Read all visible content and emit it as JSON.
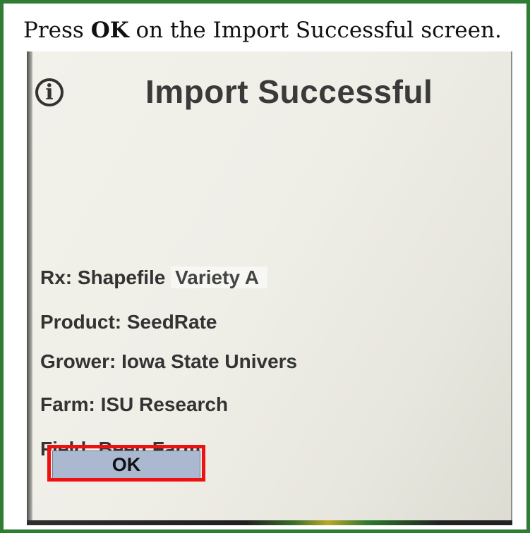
{
  "instruction": {
    "prefix": "Press ",
    "emphasis": "OK",
    "suffix": " on the Import Successful screen."
  },
  "dialog": {
    "icon": "info-icon",
    "title": "Import Successful",
    "lines": [
      {
        "label": "Rx: Shapefile",
        "value": "Variety A"
      },
      {
        "label": "Product: SeedRate"
      },
      {
        "label": "Grower: Iowa State Univers"
      },
      {
        "label": "Farm: ISU Research"
      },
      {
        "label": "Field: Been Farm"
      }
    ],
    "ok_label": "OK"
  },
  "colors": {
    "frame_border": "#2e7d32",
    "highlight": "#ee1111",
    "ok_button": "#aab8d0"
  }
}
